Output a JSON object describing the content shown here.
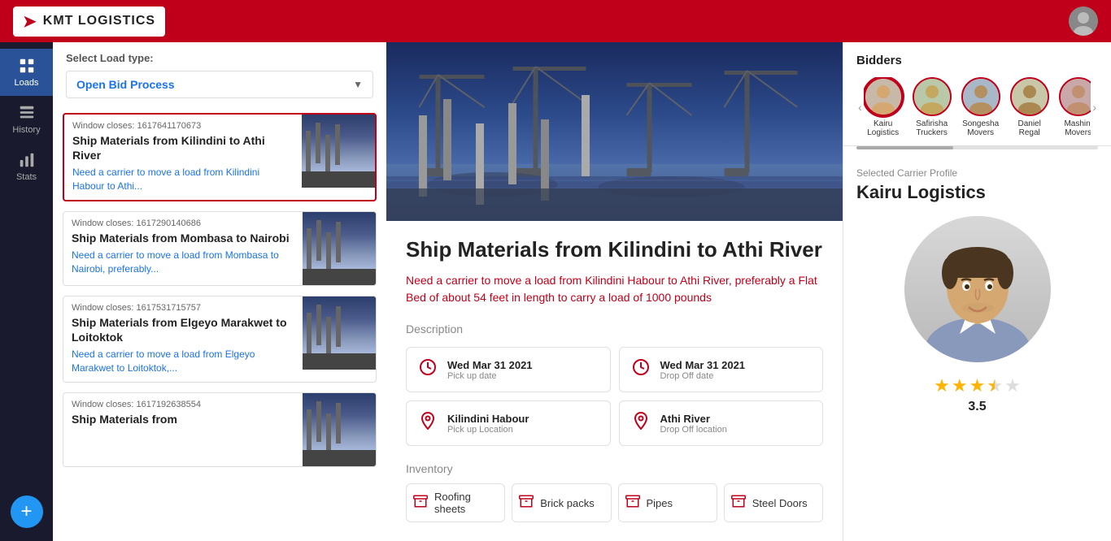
{
  "app": {
    "name": "KMT LOGISTICS"
  },
  "header": {
    "logo_text": "KMT  LOGISTICS"
  },
  "sidebar": {
    "items": [
      {
        "label": "Loads",
        "icon": "grid"
      },
      {
        "label": "History",
        "icon": "table"
      },
      {
        "label": "Stats",
        "icon": "chart"
      }
    ],
    "active": 0,
    "add_label": "+"
  },
  "left_panel": {
    "select_load_label": "Select Load type:",
    "dropdown_value": "Open Bid Process",
    "cards": [
      {
        "window_closes": "Window closes: 1617641170673",
        "title": "Ship Materials from Kilindini to Athi River",
        "desc": "Need a carrier to move a load from Kilindini Habour to Athi...",
        "selected": true
      },
      {
        "window_closes": "Window closes: 1617290140686",
        "title": "Ship Materials from Mombasa to Nairobi",
        "desc": "Need a carrier to move a load from Mombasa to Nairobi, preferably...",
        "selected": false
      },
      {
        "window_closes": "Window closes: 1617531715757",
        "title": "Ship Materials from Elgeyo Marakwet to Loitoktok",
        "desc": "Need a carrier to move a load from Elgeyo Marakwet to Loitoktok,...",
        "selected": false
      },
      {
        "window_closes": "Window closes: 1617192638554",
        "title": "Ship Materials from",
        "desc": "",
        "selected": false
      }
    ]
  },
  "center_panel": {
    "main_title": "Ship Materials from Kilindini to Athi River",
    "subtitle": "Need a carrier to move a load from Kilindini Habour to Athi River, preferably a Flat Bed of about 54 feet in length to carry a load of 1000 pounds",
    "description_label": "Description",
    "desc_cards": [
      {
        "icon": "clock",
        "label": "Wed Mar 31 2021",
        "sublabel": "Pick up date"
      },
      {
        "icon": "clock",
        "label": "Wed Mar 31 2021",
        "sublabel": "Drop Off date"
      },
      {
        "icon": "pin",
        "label": "Kilindini Habour",
        "sublabel": "Pick up Location"
      },
      {
        "icon": "pin",
        "label": "Athi River",
        "sublabel": "Drop Off location"
      }
    ],
    "inventory_label": "Inventory",
    "inventory_items": [
      {
        "label": "Roofing sheets",
        "icon": "box"
      },
      {
        "label": "Brick packs",
        "icon": "box"
      },
      {
        "label": "Pipes",
        "icon": "box"
      },
      {
        "label": "Steel Doors",
        "icon": "box"
      }
    ]
  },
  "right_panel": {
    "bidders_title": "Bidders",
    "bidders": [
      {
        "name": "Kairu Logistics",
        "active": true
      },
      {
        "name": "Safirisha Truckers",
        "active": false
      },
      {
        "name": "Songesha Movers",
        "active": false
      },
      {
        "name": "Daniel Regal",
        "active": false
      },
      {
        "name": "Mashini Movers",
        "active": false
      }
    ],
    "selected_carrier_label": "Selected Carrier Profile",
    "carrier_name": "Kairu Logistics",
    "rating": 3.5,
    "rating_max": 5
  }
}
